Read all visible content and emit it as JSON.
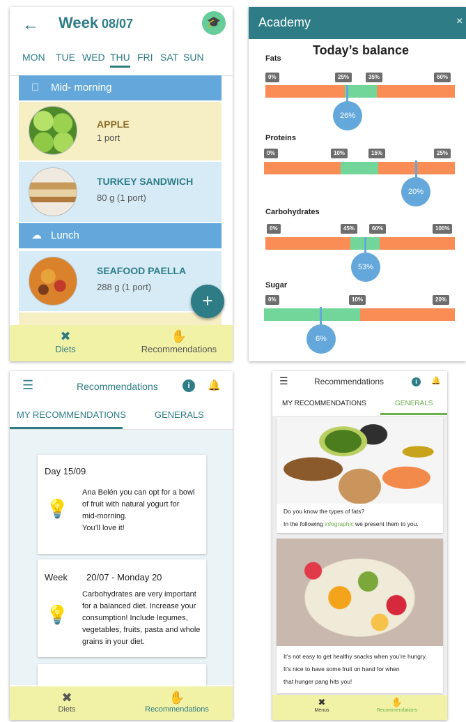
{
  "week_screen": {
    "title": "Week",
    "date": "08/07",
    "days": [
      "MON",
      "TUE",
      "WED",
      "THU",
      "FRI",
      "SAT",
      "SUN"
    ],
    "active_day": "THU",
    "sections": [
      {
        "label": "Mid- morning",
        "icon": "apple-icon"
      },
      {
        "label": "Lunch",
        "icon": "cloche-icon"
      }
    ],
    "meals": [
      {
        "name": "APPLE",
        "qty": "1 port",
        "image": "apple-photo"
      },
      {
        "name": "TURKEY SANDWICH",
        "qty": "80 g (1 port)",
        "image": "sandwich-photo"
      },
      {
        "name": "SEAFOOD PAELLA",
        "qty": "288 g (1 port)",
        "image": "paella-photo"
      }
    ],
    "fab": "+",
    "nav": {
      "diets": "Diets",
      "recommendations": "Recommendations"
    }
  },
  "academy": {
    "header": "Academy",
    "close": "×",
    "title": "Today’s balance",
    "nutrients": [
      {
        "label": "Fats",
        "ticks": [
          "0%",
          "25%",
          "35%",
          "60%"
        ],
        "value": "26%"
      },
      {
        "label": "Proteins",
        "ticks": [
          "0%",
          "10%",
          "15%",
          "25%"
        ],
        "value": "20%"
      },
      {
        "label": "Carbohydrates",
        "ticks": [
          "0%",
          "45%",
          "60%",
          "100%"
        ],
        "value": "53%"
      },
      {
        "label": "Sugar",
        "ticks": [
          "0%",
          "10%",
          "20%"
        ],
        "value": "6%"
      }
    ]
  },
  "recommendations": {
    "title": "Recommendations",
    "info": "i",
    "tabs": {
      "mine": "MY RECOMMENDATIONS",
      "general": "GENERALS"
    },
    "card1": {
      "head": "Day  15/09",
      "lines": [
        "Ana Belén you can opt for a bowl",
        "of fruit with natural yogurt for",
        "mid-morning.",
        "You’ll love it!"
      ]
    },
    "card2": {
      "head_label": "Week",
      "head_range": "20/07 -  Monday 20",
      "lines": [
        "Carbohydrates are very important",
        "for a balanced diet. Increase your",
        "consumption! Include legumes,",
        "vegetables, fruits, pasta and whole",
        "grains in your diet."
      ]
    },
    "nav": {
      "diets": "Diets",
      "recommendations": "Recommendations"
    }
  },
  "generals": {
    "title": "Recommendations",
    "info": "i",
    "tabs": {
      "mine": "MY RECOMMENDATIONS",
      "general": "GENERALS"
    },
    "card1": {
      "line1": "Do you know the types of fats?",
      "line2_pre": "In the following ",
      "line2_link": "infographic",
      "line2_post": " we present them to you."
    },
    "card2": {
      "lines": [
        "It’s not easy to get healthy snacks when you’re hungry.",
        "It’s nice to have some fruit on hand for when",
        "that hunger pang hits you!"
      ]
    },
    "nav": {
      "menus": "Menus",
      "recommendations": "Recommendations"
    }
  },
  "colors": {
    "teal": "#2e7d86",
    "blue": "#64a8db",
    "orange": "#fa8c55",
    "green": "#72d69b",
    "nav_yellow": "#f2f2a6"
  }
}
